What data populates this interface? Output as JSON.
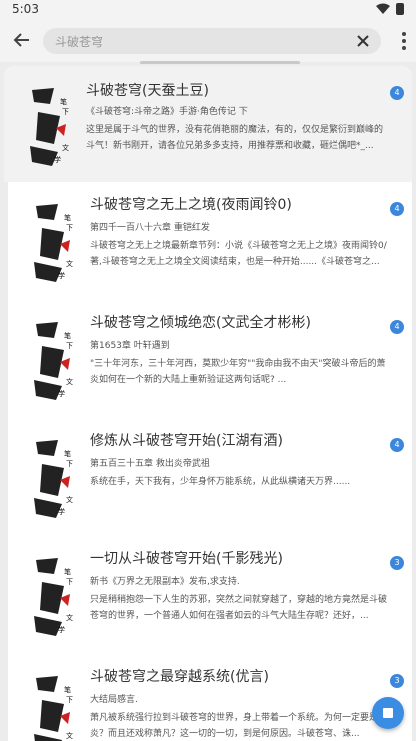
{
  "status": {
    "time": "5:03"
  },
  "search": {
    "query": "斗破苍穹"
  },
  "results": [
    {
      "title": "斗破苍穹(天蚕土豆)",
      "meta": "《斗破苍穹:斗帝之路》手游·角色传记 下",
      "desc": "这里是属于斗气的世界，没有花俏艳丽的魔法，有的，仅仅是繁衍到巅峰的斗气！新书刚开，请各位兄弟多多支持，用推荐票和收藏，砸烂偶吧*_...",
      "badge": "4"
    },
    {
      "title": "斗破苍穹之无上之境(夜雨闻铃0)",
      "meta": "第四千一百八十六章 重铠红发",
      "desc": "斗破苍穹之无上之境最新章节列：小说《斗破苍穹之无上之境》夜雨闻铃0/著,斗破苍穹之无上之境全文阅读结束，也是一种开始......《斗破苍穹之...",
      "badge": "4"
    },
    {
      "title": "斗破苍穹之倾城绝恋(文武全才彬彬)",
      "meta": "第1653章 叶轩遇到",
      "desc": "\"三十年河东，三十年河西，莫欺少年穷\"\"我命由我不由天\"突破斗帝后的萧炎如何在一个新的大陆上重新验证这两句话呢? ...",
      "badge": "4"
    },
    {
      "title": "修炼从斗破苍穹开始(江湖有酒)",
      "meta": "第五百三十五章 救出炎帝武祖",
      "desc": "系统在手，天下我有，少年身怀万能系统，从此纵横诸天万界......",
      "badge": "4"
    },
    {
      "title": "一切从斗破苍穹开始(千影残光)",
      "meta": "新书《万界之无限副本》发布,求支持.",
      "desc": "只是稍稍抱怨一下人生的苏邪，突然之间就穿越了，穿越的地方竟然是斗破苍穹的世界，一个普通人如何在强者如云的斗气大陆生存呢？还好，...",
      "badge": "3"
    },
    {
      "title": "斗破苍穹之最穿越系统(优言)",
      "meta": "大结局感言.",
      "desc": "萧凡被系统强行拉到斗破苍穹的世界，身上带着一个系统。为何一定要是萧炎？而且还戏称萧凡？这一切的一切，到是何原因。斗破苍穹、诛...",
      "badge": "3"
    }
  ],
  "cover_text": [
    "笔",
    "下",
    "文",
    "学"
  ]
}
